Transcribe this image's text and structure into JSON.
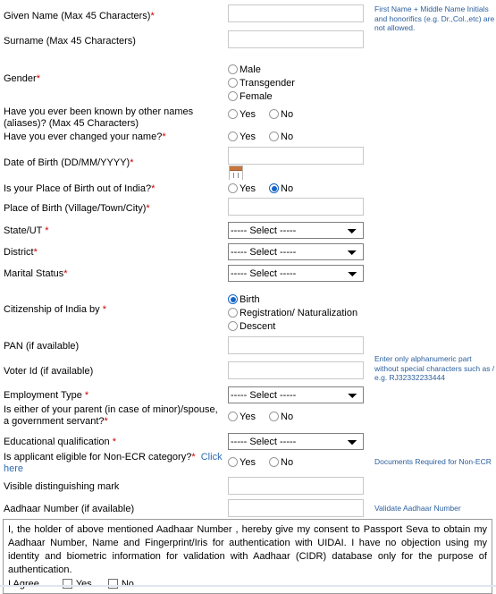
{
  "form": {
    "fields": {
      "given_name": {
        "label": "Given Name (Max 45 Characters)",
        "required": true,
        "value": "",
        "hint": "First Name + Middle Name Initials and honorifics (e.g. Dr.,Col.,etc) are not allowed."
      },
      "surname": {
        "label": "Surname (Max 45 Characters)",
        "required": false,
        "value": ""
      },
      "gender": {
        "label": "Gender",
        "required": true,
        "options": [
          "Male",
          "Transgender",
          "Female"
        ],
        "selected": ""
      },
      "aliases": {
        "label": "Have you ever been known by other names (aliases)? (Max 45 Characters)",
        "required": false,
        "options": [
          "Yes",
          "No"
        ],
        "selected": ""
      },
      "changed_name": {
        "label": "Have you ever changed your name?",
        "required": true,
        "options": [
          "Yes",
          "No"
        ],
        "selected": ""
      },
      "dob": {
        "label": "Date of Birth (DD/MM/YYYY)",
        "required": true,
        "value": "",
        "calendar_icon": "calendar-icon"
      },
      "pob_out_of_india": {
        "label": "Is your Place of Birth out of India?",
        "required": true,
        "options": [
          "Yes",
          "No"
        ],
        "selected": "No"
      },
      "place_of_birth": {
        "label": "Place of Birth (Village/Town/City)",
        "required": true,
        "value": ""
      },
      "state_ut": {
        "label": "State/UT",
        "required": true,
        "selected": "----- Select -----",
        "options": [
          "----- Select -----"
        ]
      },
      "district": {
        "label": "District",
        "required": true,
        "selected": "----- Select -----",
        "options": [
          "----- Select -----"
        ]
      },
      "marital_status": {
        "label": "Marital Status",
        "required": true,
        "selected": "----- Select -----",
        "options": [
          "----- Select -----"
        ]
      },
      "citizenship": {
        "label": "Citizenship of India by",
        "required": true,
        "options": [
          "Birth",
          "Registration/ Naturalization",
          "Descent"
        ],
        "selected": "Birth"
      },
      "pan": {
        "label": "PAN (if available)",
        "required": false,
        "value": ""
      },
      "voter_id": {
        "label": "Voter Id (if available)",
        "required": false,
        "value": "",
        "hint": "Enter only alphanumeric part without special characters such as / e.g. RJ32332233444"
      },
      "employment_type": {
        "label": "Employment Type",
        "required": true,
        "selected": "----- Select -----",
        "options": [
          "----- Select -----"
        ]
      },
      "govt_servant": {
        "label": "Is either of your parent (in case of minor)/spouse, a government servant?",
        "required": true,
        "options": [
          "Yes",
          "No"
        ],
        "selected": ""
      },
      "education": {
        "label": "Educational qualification",
        "required": true,
        "selected": "----- Select -----",
        "options": [
          "----- Select -----"
        ]
      },
      "non_ecr": {
        "label": "Is applicant eligible for Non-ECR category?",
        "required": true,
        "link_text": "Click here",
        "options": [
          "Yes",
          "No"
        ],
        "selected": "",
        "hint": "Documents Required for Non-ECR"
      },
      "visible_mark": {
        "label": "Visible distinguishing mark",
        "required": false,
        "value": ""
      },
      "aadhaar": {
        "label": "Aadhaar Number (if available)",
        "required": false,
        "value": "",
        "hint": "Validate Aadhaar Number"
      }
    },
    "declaration": {
      "text": "I, the holder of above mentioned Aadhaar Number , hereby give my consent to Passport Seva to obtain my Aadhaar Number, Name and Fingerprint/Iris for authentication with UIDAI. I have no objection using my identity and biometric information for validation with Aadhaar (CIDR) database only for the purpose of authentication.",
      "agree_label": "I Agree",
      "yes_label": "Yes",
      "no_label": "No"
    },
    "colors": {
      "required_marker": "#cc0000",
      "link": "#2b6cb0",
      "hint": "#2b5f9e",
      "radio_selected": "#1464c8"
    }
  }
}
